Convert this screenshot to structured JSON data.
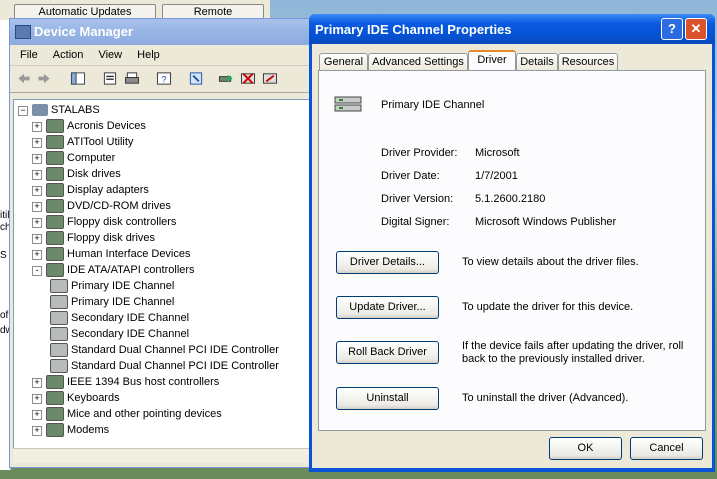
{
  "background_window": {
    "btn1": "Automatic Updates",
    "btn2": "Remote"
  },
  "left_strip_fragments": [
    "S",
    "ofi",
    "dw",
    "itil",
    "ch"
  ],
  "device_manager": {
    "title": "Device Manager",
    "menu": [
      "File",
      "Action",
      "View",
      "Help"
    ],
    "tree": {
      "root": "STALABS",
      "items": [
        {
          "label": "Acronis Devices",
          "level": 1,
          "exp": "+"
        },
        {
          "label": "ATITool Utility",
          "level": 1,
          "exp": "+"
        },
        {
          "label": "Computer",
          "level": 1,
          "exp": "+"
        },
        {
          "label": "Disk drives",
          "level": 1,
          "exp": "+"
        },
        {
          "label": "Display adapters",
          "level": 1,
          "exp": "+"
        },
        {
          "label": "DVD/CD-ROM drives",
          "level": 1,
          "exp": "+"
        },
        {
          "label": "Floppy disk controllers",
          "level": 1,
          "exp": "+"
        },
        {
          "label": "Floppy disk drives",
          "level": 1,
          "exp": "+"
        },
        {
          "label": "Human Interface Devices",
          "level": 1,
          "exp": "+"
        },
        {
          "label": "IDE ATA/ATAPI controllers",
          "level": 1,
          "exp": "-"
        },
        {
          "label": "Primary IDE Channel",
          "level": 2,
          "exp": ""
        },
        {
          "label": "Primary IDE Channel",
          "level": 2,
          "exp": ""
        },
        {
          "label": "Secondary IDE Channel",
          "level": 2,
          "exp": ""
        },
        {
          "label": "Secondary IDE Channel",
          "level": 2,
          "exp": ""
        },
        {
          "label": "Standard Dual Channel PCI IDE Controller",
          "level": 2,
          "exp": ""
        },
        {
          "label": "Standard Dual Channel PCI IDE Controller",
          "level": 2,
          "exp": ""
        },
        {
          "label": "IEEE 1394 Bus host controllers",
          "level": 1,
          "exp": "+"
        },
        {
          "label": "Keyboards",
          "level": 1,
          "exp": "+"
        },
        {
          "label": "Mice and other pointing devices",
          "level": 1,
          "exp": "+"
        },
        {
          "label": "Modems",
          "level": 1,
          "exp": "+"
        }
      ]
    }
  },
  "dialog": {
    "title": "Primary IDE Channel Properties",
    "help_glyph": "?",
    "close_glyph": "✕",
    "tabs": [
      "General",
      "Advanced Settings",
      "Driver",
      "Details",
      "Resources"
    ],
    "active_tab": "Driver",
    "device_name": "Primary IDE Channel",
    "fields": [
      {
        "label": "Driver Provider:",
        "value": "Microsoft"
      },
      {
        "label": "Driver Date:",
        "value": "1/7/2001"
      },
      {
        "label": "Driver Version:",
        "value": "5.1.2600.2180"
      },
      {
        "label": "Digital Signer:",
        "value": "Microsoft Windows Publisher"
      }
    ],
    "actions": [
      {
        "button": "Driver Details...",
        "desc": "To view details about the driver files."
      },
      {
        "button": "Update Driver...",
        "desc": "To update the driver for this device."
      },
      {
        "button": "Roll Back Driver",
        "desc": "If the device fails after updating the driver, roll back to the previously installed driver."
      },
      {
        "button": "Uninstall",
        "desc": "To uninstall the driver (Advanced)."
      }
    ],
    "ok": "OK",
    "cancel": "Cancel"
  }
}
